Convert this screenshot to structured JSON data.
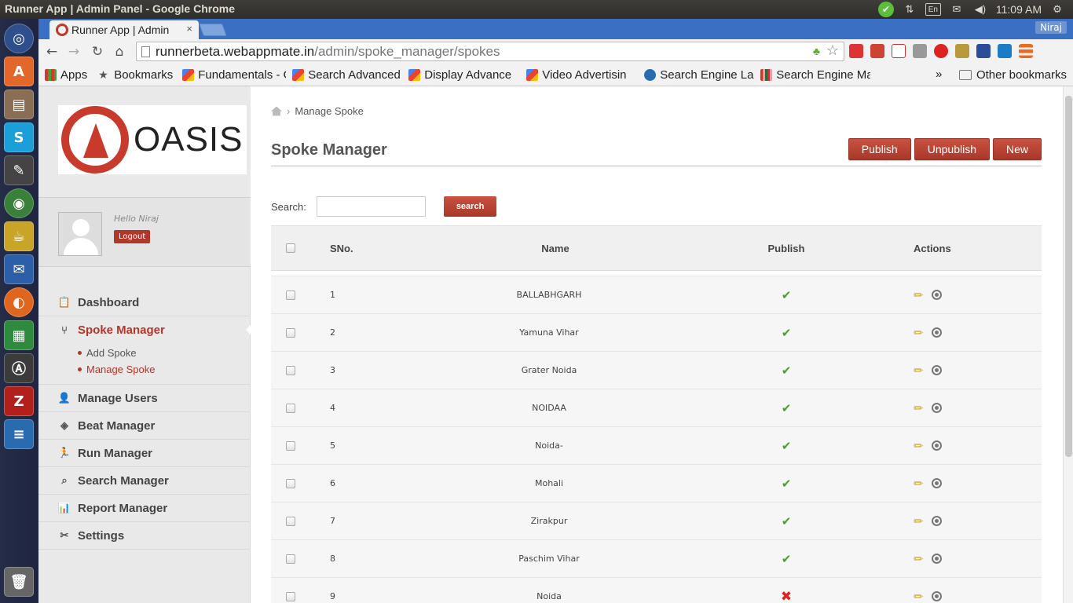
{
  "os": {
    "window_title": "Runner App | Admin Panel - Google Chrome",
    "time": "11:09 AM",
    "keyboard": "En"
  },
  "browser": {
    "tab_title": "Runner App | Admin",
    "tab_close": "×",
    "user": "Niraj",
    "url_host": "runnerbeta.webappmate.in",
    "url_path": "/admin/spoke_manager/spokes",
    "bookmarks": [
      "Apps",
      "Bookmarks",
      "Fundamentals - G",
      "Search Advanced",
      "Display Advance",
      "Video Advertisin",
      "Search Engine La",
      "Search Engine Ma"
    ],
    "more": "»",
    "other_bookmarks": "Other bookmarks"
  },
  "sidebar": {
    "logo_text": "OASIS",
    "hello": "Hello Niraj",
    "logout": "Logout",
    "menu": [
      {
        "label": "Dashboard",
        "icon": "clipboard-icon"
      },
      {
        "label": "Spoke Manager",
        "icon": "spoke-icon",
        "active": true
      },
      {
        "label": "Manage Users",
        "icon": "user-icon"
      },
      {
        "label": "Beat Manager",
        "icon": "beat-icon"
      },
      {
        "label": "Run Manager",
        "icon": "run-icon"
      },
      {
        "label": "Search Manager",
        "icon": "search-manager-icon"
      },
      {
        "label": "Report Manager",
        "icon": "report-icon"
      },
      {
        "label": "Settings",
        "icon": "settings-icon"
      }
    ],
    "submenu": [
      "Add Spoke",
      "Manage Spoke"
    ]
  },
  "main": {
    "breadcrumb": "Manage Spoke",
    "title": "Spoke Manager",
    "buttons": {
      "publish": "Publish",
      "unpublish": "Unpublish",
      "new": "New"
    },
    "search_label": "Search:",
    "search_button": "search",
    "table": {
      "headers": {
        "sno": "SNo.",
        "name": "Name",
        "publish": "Publish",
        "actions": "Actions"
      },
      "rows": [
        {
          "sno": "1",
          "name": "BALLABHGARH",
          "published": true
        },
        {
          "sno": "2",
          "name": "Yamuna Vihar",
          "published": true
        },
        {
          "sno": "3",
          "name": "Grater Noida",
          "published": true
        },
        {
          "sno": "4",
          "name": "NOIDAA",
          "published": true
        },
        {
          "sno": "5",
          "name": "Noida-",
          "published": true
        },
        {
          "sno": "6",
          "name": "Mohali",
          "published": true
        },
        {
          "sno": "7",
          "name": "Zirakpur",
          "published": true
        },
        {
          "sno": "8",
          "name": "Paschim Vihar",
          "published": true
        },
        {
          "sno": "9",
          "name": "Noida",
          "published": false
        }
      ]
    }
  }
}
